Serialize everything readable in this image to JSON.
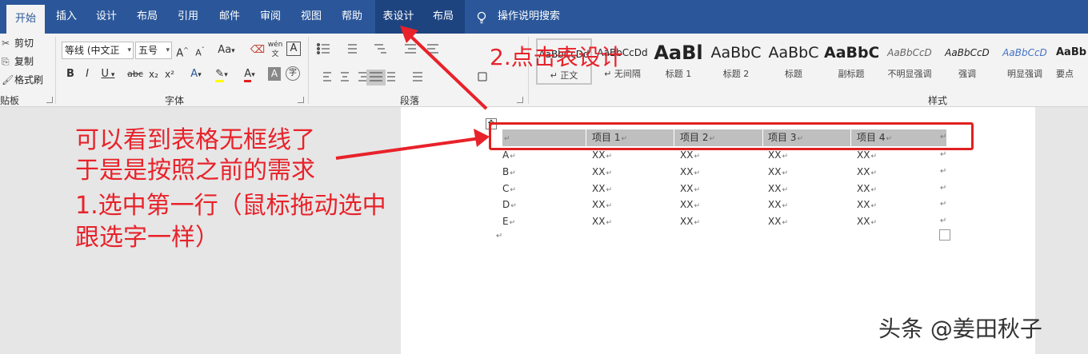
{
  "tabs": [
    {
      "label": "开始",
      "active": true
    },
    {
      "label": "插入"
    },
    {
      "label": "设计"
    },
    {
      "label": "布局"
    },
    {
      "label": "引用"
    },
    {
      "label": "邮件"
    },
    {
      "label": "审阅"
    },
    {
      "label": "视图"
    },
    {
      "label": "帮助"
    },
    {
      "label": "表设计",
      "context": true
    },
    {
      "label": "布局",
      "context": true
    }
  ],
  "tell_me": "操作说明搜索",
  "clipboard": {
    "cut": "剪切",
    "copy": "复制",
    "format_painter": "格式刷",
    "group_label": "贴板"
  },
  "font": {
    "family": "等线 (中文正",
    "size": "五号",
    "grow": "A",
    "shrink": "A",
    "case": "Aa",
    "bold": "B",
    "italic": "I",
    "underline": "U",
    "strike": "abc",
    "subscript": "x₂",
    "superscript": "x²",
    "phonetic": "wén",
    "border": "A",
    "effects": "A",
    "color": "A",
    "shading": "A",
    "enclose": "字",
    "group_label": "字体"
  },
  "paragraph": {
    "group_label": "段落"
  },
  "styles": {
    "group_label": "样式",
    "items": [
      {
        "sample": "AaBbCcDd",
        "name": "正文",
        "selected": true
      },
      {
        "sample": "AaBbCcDd",
        "name": "无间隔"
      },
      {
        "sample": "AaBl",
        "name": "标题 1"
      },
      {
        "sample": "AaBbC",
        "name": "标题 2"
      },
      {
        "sample": "AaBbC",
        "name": "标题"
      },
      {
        "sample": "AaBbC",
        "name": "副标题"
      },
      {
        "sample": "AaBbCcD",
        "name": "不明显强调"
      },
      {
        "sample": "AaBbCcD",
        "name": "强调"
      },
      {
        "sample": "AaBbCcD",
        "name": "明显强调"
      },
      {
        "sample": "AaBb",
        "name": "要点"
      }
    ]
  },
  "table": {
    "header": [
      "",
      "项目 1",
      "项目 2",
      "项目 3",
      "项目 4"
    ],
    "rows": [
      [
        "A",
        "XX",
        "XX",
        "XX",
        "XX"
      ],
      [
        "B",
        "XX",
        "XX",
        "XX",
        "XX"
      ],
      [
        "C",
        "XX",
        "XX",
        "XX",
        "XX"
      ],
      [
        "D",
        "XX",
        "XX",
        "XX",
        "XX"
      ],
      [
        "E",
        "XX",
        "XX",
        "XX",
        "XX"
      ]
    ]
  },
  "annotations": {
    "line1": "可以看到表格无框线了",
    "line2": "于是是按照之前的需求",
    "line3": "1.选中第一行（鼠标拖动选中",
    "line4": "跟选字一样）",
    "step2": "2.点击表设计"
  },
  "watermark": "头条 @姜田秋子",
  "colors": {
    "accent": "#2b579a",
    "annotation_red": "#e8222a",
    "selection_gray": "#bfbfbf"
  }
}
